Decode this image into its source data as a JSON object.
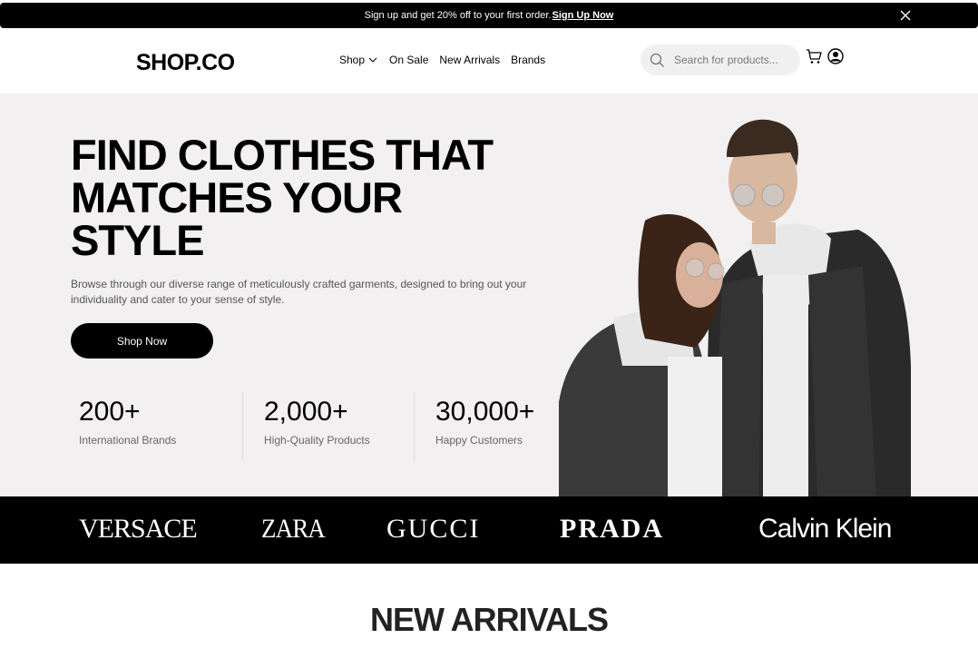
{
  "promo": {
    "text": "Sign up and get 20% off to your first order.",
    "link": "Sign Up Now"
  },
  "header": {
    "logo": "SHOP.CO",
    "nav": [
      {
        "label": "Shop",
        "icon": "chevron-down-icon"
      },
      {
        "label": "On Sale"
      },
      {
        "label": "New Arrivals"
      },
      {
        "label": "Brands"
      }
    ],
    "search": {
      "placeholder": "Search for products...",
      "value": ""
    },
    "icons": [
      "search-icon",
      "cart-icon",
      "user-icon",
      "close-icon"
    ]
  },
  "hero": {
    "title_lines": [
      "FIND CLOTHES THAT",
      "MATCHES YOUR",
      "STYLE"
    ],
    "description": "Browse through our diverse range of meticulously crafted garments, designed to bring out your individuality and cater to your sense of style.",
    "cta": "Shop Now",
    "stats": [
      {
        "value": "200+",
        "label": "International Brands"
      },
      {
        "value": "2,000+",
        "label": "High-Quality Products"
      },
      {
        "value": "30,000+",
        "label": "Happy Customers"
      }
    ]
  },
  "brands": [
    "VERSACE",
    "ZARA",
    "GUCCI",
    "PRADA",
    "Calvin Klein"
  ],
  "sections": {
    "new_arrivals": "NEW ARRIVALS"
  },
  "colors": {
    "black": "#000000",
    "hero_bg": "#f2f0f1",
    "search_bg": "#f0f0f0"
  }
}
